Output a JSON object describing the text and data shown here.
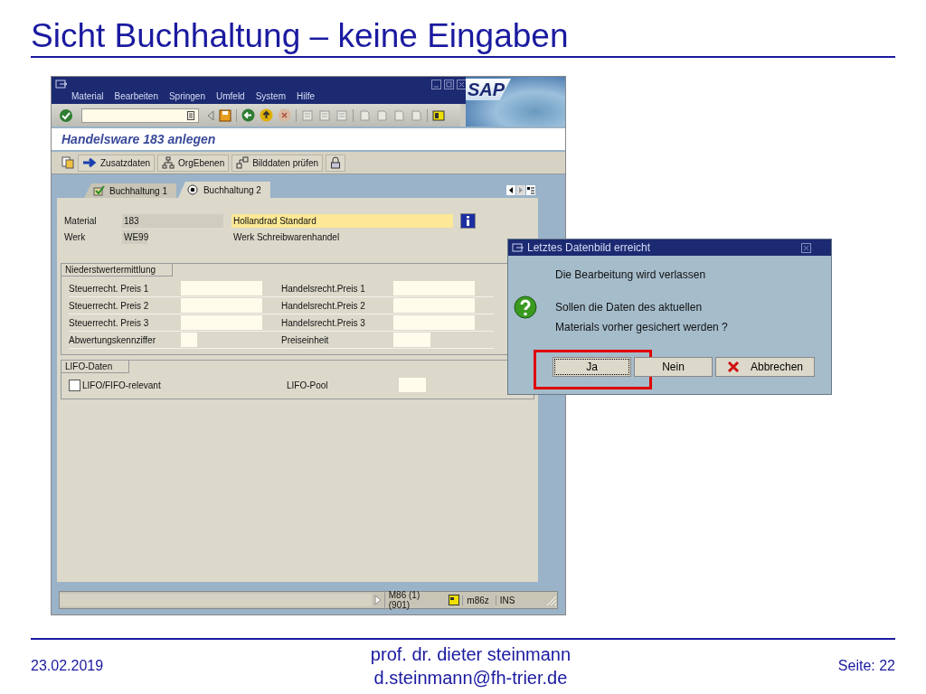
{
  "slide": {
    "title": "Sicht Buchhaltung – keine Eingaben"
  },
  "window": {
    "menu": [
      "Material",
      "Bearbeiten",
      "Springen",
      "Umfeld",
      "System",
      "Hilfe"
    ],
    "logo": "SAP",
    "screen_title": "Handelsware 183 anlegen",
    "app_toolbar": [
      {
        "label": "Zusatzdaten",
        "kind": "arrow"
      },
      {
        "label": "OrgEbenen",
        "kind": "org"
      },
      {
        "label": "Bilddaten prüfen",
        "kind": "check"
      }
    ],
    "tabs": [
      {
        "label": "Buchhaltung 1",
        "selected": false
      },
      {
        "label": "Buchhaltung 2",
        "selected": true
      }
    ],
    "header": [
      {
        "label": "Material",
        "value": "183",
        "description": "Hollandrad Standard"
      },
      {
        "label": "Werk",
        "value": "WE99",
        "description": "Werk Schreibwarenhandel"
      }
    ],
    "valuation": {
      "title": "Niederstwertermittlung",
      "left": [
        {
          "label": "Steuerrecht. Preis 1",
          "kind": "long"
        },
        {
          "label": "Steuerrecht. Preis 2",
          "kind": "long"
        },
        {
          "label": "Steuerrecht. Preis 3",
          "kind": "long"
        },
        {
          "label": "Abwertungskennziffer",
          "kind": "short"
        }
      ],
      "right": [
        {
          "label": "Handelsrecht.Preis 1",
          "kind": "long"
        },
        {
          "label": "Handelsrecht.Preis 2",
          "kind": "long"
        },
        {
          "label": "Handelsrecht.Preis 3",
          "kind": "long"
        },
        {
          "label": "Preiseinheit",
          "kind": "short"
        }
      ]
    },
    "lifo": {
      "title": "LIFO-Daten",
      "checkbox": {
        "label": "LIFO/FIFO-relevant",
        "checked": false
      },
      "field": {
        "label": "LIFO-Pool"
      }
    },
    "status_bar": [
      "M86 (1) (901)",
      "m86z",
      "INS"
    ]
  },
  "dialog": {
    "title": "Letztes Datenbild erreicht",
    "lines": [
      "Die Bearbeitung wird verlassen",
      "Sollen die Daten des aktuellen",
      "Materials vorher gesichert werden ?"
    ],
    "buttons": [
      {
        "label": "Ja",
        "focused": true,
        "highlighted": true,
        "kind": "plain"
      },
      {
        "label": "Nein",
        "focused": false,
        "highlighted": false,
        "kind": "plain"
      },
      {
        "label": "Abbrechen",
        "focused": false,
        "highlighted": false,
        "kind": "cancel"
      }
    ]
  },
  "footer": {
    "date": "23.02.2019",
    "author": "prof. dr. dieter steinmann",
    "email": "d.steinmann@fh-trier.de",
    "page": "Seite: 22"
  }
}
